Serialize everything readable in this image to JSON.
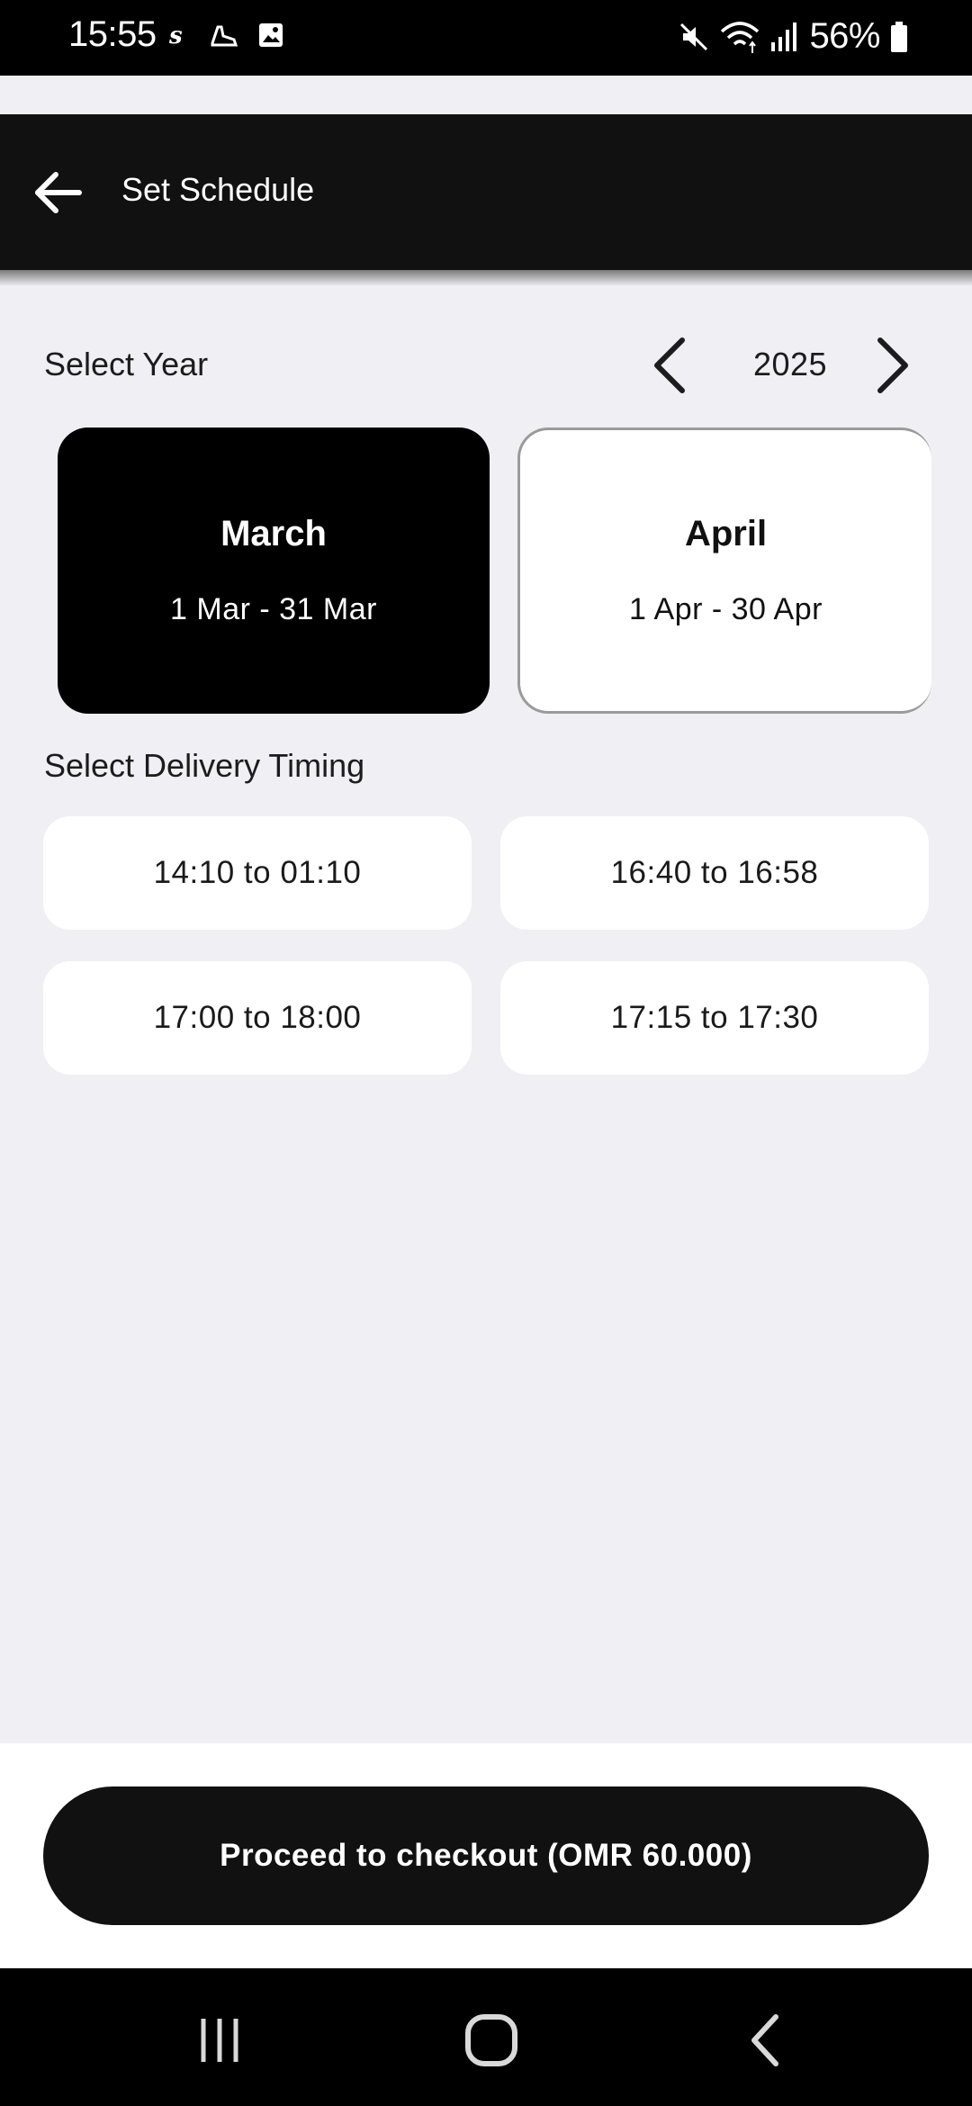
{
  "status_bar": {
    "time": "15:55",
    "battery": "56%",
    "left_icons": [
      "s-app-icon",
      "sneaker-icon",
      "gallery-icon"
    ],
    "right_icons": [
      "mute-icon",
      "wifi-icon",
      "signal-icon",
      "battery-icon"
    ]
  },
  "app_bar": {
    "title": "Set Schedule"
  },
  "year_selector": {
    "label": "Select Year",
    "year": "2025"
  },
  "months": [
    {
      "name": "March",
      "range": "1 Mar - 31 Mar",
      "selected": true
    },
    {
      "name": "April",
      "range": "1 Apr - 30 Apr",
      "selected": false
    }
  ],
  "delivery": {
    "label": "Select Delivery Timing",
    "slots": [
      "14:10 to 01:10",
      "16:40 to 16:58",
      "17:00 to 18:00",
      "17:15 to 17:30"
    ]
  },
  "checkout": {
    "label": "Proceed to checkout (OMR 60.000)"
  },
  "colors": {
    "background": "#efeff4",
    "app_bar": "#111112",
    "accent": "#000000",
    "card": "#ffffff"
  }
}
